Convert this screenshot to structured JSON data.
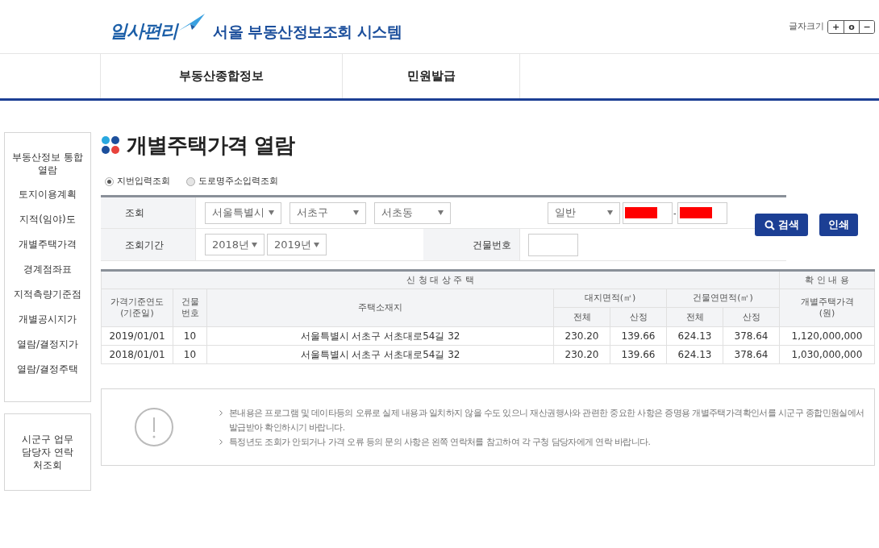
{
  "header": {
    "logo_text": "일사편리",
    "system_title": "서울 부동산정보조회 시스템",
    "font_size": {
      "label": "글자크기",
      "buttons": [
        "+",
        "o",
        "−"
      ]
    }
  },
  "nav": [
    {
      "label": "부동산종합정보"
    },
    {
      "label": "민원발급"
    }
  ],
  "sidebar": {
    "items": [
      {
        "label": "부동산정보 통합 열람"
      },
      {
        "label": "토지이용계획"
      },
      {
        "label": "지적(임야)도"
      },
      {
        "label": "개별주택가격"
      },
      {
        "label": "경계점좌표"
      },
      {
        "label": "지적측량기준점"
      },
      {
        "label": "개별공시지가"
      },
      {
        "label": "열람/결정지가"
      },
      {
        "label": "열람/결정주택"
      }
    ],
    "contact": "시군구 업무담당자 연락처조회"
  },
  "page_title": "개별주택가격 열람",
  "search_modes": [
    {
      "label": "지번입력조회",
      "selected": true
    },
    {
      "label": "도로명주소입력조회",
      "selected": false
    }
  ],
  "search_form": {
    "row_1_label": "조회",
    "city": "서울특별시",
    "district": "서초구",
    "dong": "서초동",
    "lot_type": "일반",
    "lot_main": {
      "redacted": true
    },
    "lot_separator": "-",
    "lot_sub": {
      "redacted": true
    },
    "row_2_label": "조회기간",
    "year_from": "2018년",
    "year_to": "2019년",
    "building_no_label": "건물번호"
  },
  "buttons": {
    "search": "검색",
    "print": "인쇄"
  },
  "results": {
    "group_headers": [
      "신 청 대 상 주 택",
      "확 인 내 용"
    ],
    "columns": {
      "year": "가격기준연도 (기준일)",
      "building_no": "건물 번호",
      "address": "주택소재지",
      "land_area": "대지면적(㎡)",
      "building_area": "건물연면적(㎡)",
      "land_total": "전체",
      "land_share": "산정",
      "building_total": "전체",
      "building_share": "산정",
      "price": "개별주택가격 (원)"
    },
    "rows": [
      [
        "2019/01/01",
        "10",
        "서울특별시 서초구 서초대로54길 32",
        "230.20",
        "139.66",
        "624.13",
        "378.64",
        "1,120,000,000"
      ],
      [
        "2018/01/01",
        "10",
        "서울특별시 서초구 서초대로54길 32",
        "230.20",
        "139.66",
        "624.13",
        "378.64",
        "1,030,000,000"
      ]
    ]
  },
  "notice": [
    "본내용은 프로그램 및 데이타등의 오류로 실제 내용과 일치하지 않을 수도 있으니 재산권행사와 관련한 중요한 사항은 증명용 개별주택가격확인서를 시군구 종합민원실에서 발급받아 확인하시기 바랍니다.",
    "특정년도 조회가 안되거나 가격 오류 등의 문의 사항은 왼쪽 연락처를 참고하여 각 구청 담당자에게 연락 바랍니다."
  ]
}
